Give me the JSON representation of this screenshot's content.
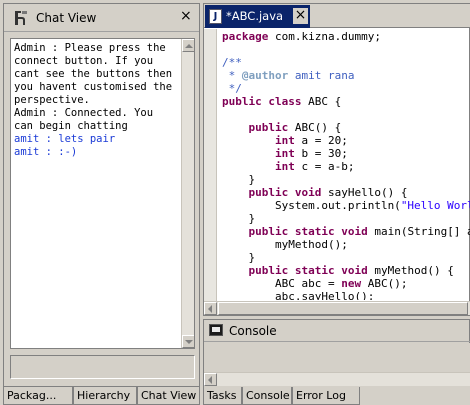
{
  "chat_view": {
    "title": "Chat View",
    "close_label": "×",
    "messages": [
      {
        "text": "Admin : Please press the connect button. If you cant see the buttons then you havent customised the perspective.",
        "role": "admin"
      },
      {
        "text": "Admin : Connected. You can begin chatting",
        "role": "admin"
      },
      {
        "text": "amit : lets pair",
        "role": "user"
      },
      {
        "text": "amit : :-)",
        "role": "user"
      }
    ],
    "input_value": ""
  },
  "left_tabs": [
    "Packag...",
    "Hierarchy",
    "Chat View"
  ],
  "editor": {
    "tab_label": "*ABC.java",
    "tab_icon": "J",
    "close_label": "×",
    "lines": [
      [
        {
          "t": "package",
          "c": "kw"
        },
        {
          "t": " com.kizna.dummy;",
          "c": ""
        }
      ],
      [],
      [
        {
          "t": "/**",
          "c": "cm"
        }
      ],
      [
        {
          "t": " * ",
          "c": "cm"
        },
        {
          "t": "@author",
          "c": "tag"
        },
        {
          "t": " amit rana",
          "c": "cm"
        }
      ],
      [
        {
          "t": " */",
          "c": "cm"
        }
      ],
      [
        {
          "t": "public class",
          "c": "kw"
        },
        {
          "t": " ABC {",
          "c": ""
        }
      ],
      [],
      [
        {
          "t": "    ",
          "c": ""
        },
        {
          "t": "public",
          "c": "kw"
        },
        {
          "t": " ABC() {",
          "c": ""
        }
      ],
      [
        {
          "t": "        ",
          "c": ""
        },
        {
          "t": "int",
          "c": "kw"
        },
        {
          "t": " a = 20;",
          "c": ""
        }
      ],
      [
        {
          "t": "        ",
          "c": ""
        },
        {
          "t": "int",
          "c": "kw"
        },
        {
          "t": " b = 30;",
          "c": ""
        }
      ],
      [
        {
          "t": "        ",
          "c": ""
        },
        {
          "t": "int",
          "c": "kw"
        },
        {
          "t": " c = a-b;",
          "c": ""
        }
      ],
      [
        {
          "t": "    }",
          "c": ""
        }
      ],
      [
        {
          "t": "    ",
          "c": ""
        },
        {
          "t": "public void",
          "c": "kw"
        },
        {
          "t": " sayHello() {",
          "c": ""
        }
      ],
      [
        {
          "t": "        System.out.println(",
          "c": ""
        },
        {
          "t": "\"Hello World\"",
          "c": "str"
        },
        {
          "t": ");",
          "c": ""
        }
      ],
      [
        {
          "t": "    }",
          "c": ""
        }
      ],
      [
        {
          "t": "    ",
          "c": ""
        },
        {
          "t": "public static void",
          "c": "kw"
        },
        {
          "t": " main(String[] args) {",
          "c": ""
        }
      ],
      [
        {
          "t": "        myMethod();",
          "c": ""
        }
      ],
      [
        {
          "t": "    }",
          "c": ""
        }
      ],
      [
        {
          "t": "    ",
          "c": ""
        },
        {
          "t": "public static void",
          "c": "kw"
        },
        {
          "t": " myMethod() {",
          "c": ""
        }
      ],
      [
        {
          "t": "        ABC abc = ",
          "c": ""
        },
        {
          "t": "new",
          "c": "kw"
        },
        {
          "t": " ABC();",
          "c": ""
        }
      ],
      [
        {
          "t": "        abc.sayHello();",
          "c": ""
        }
      ]
    ]
  },
  "console": {
    "title": "Console"
  },
  "right_tabs": [
    "Tasks",
    "Console",
    "Error Log"
  ],
  "colors": {
    "chrome": "#d4d0c8",
    "active_tab": "#0a246a",
    "keyword": "#7f0055",
    "comment": "#3f5fbf",
    "user_message": "#1a3ad6"
  }
}
